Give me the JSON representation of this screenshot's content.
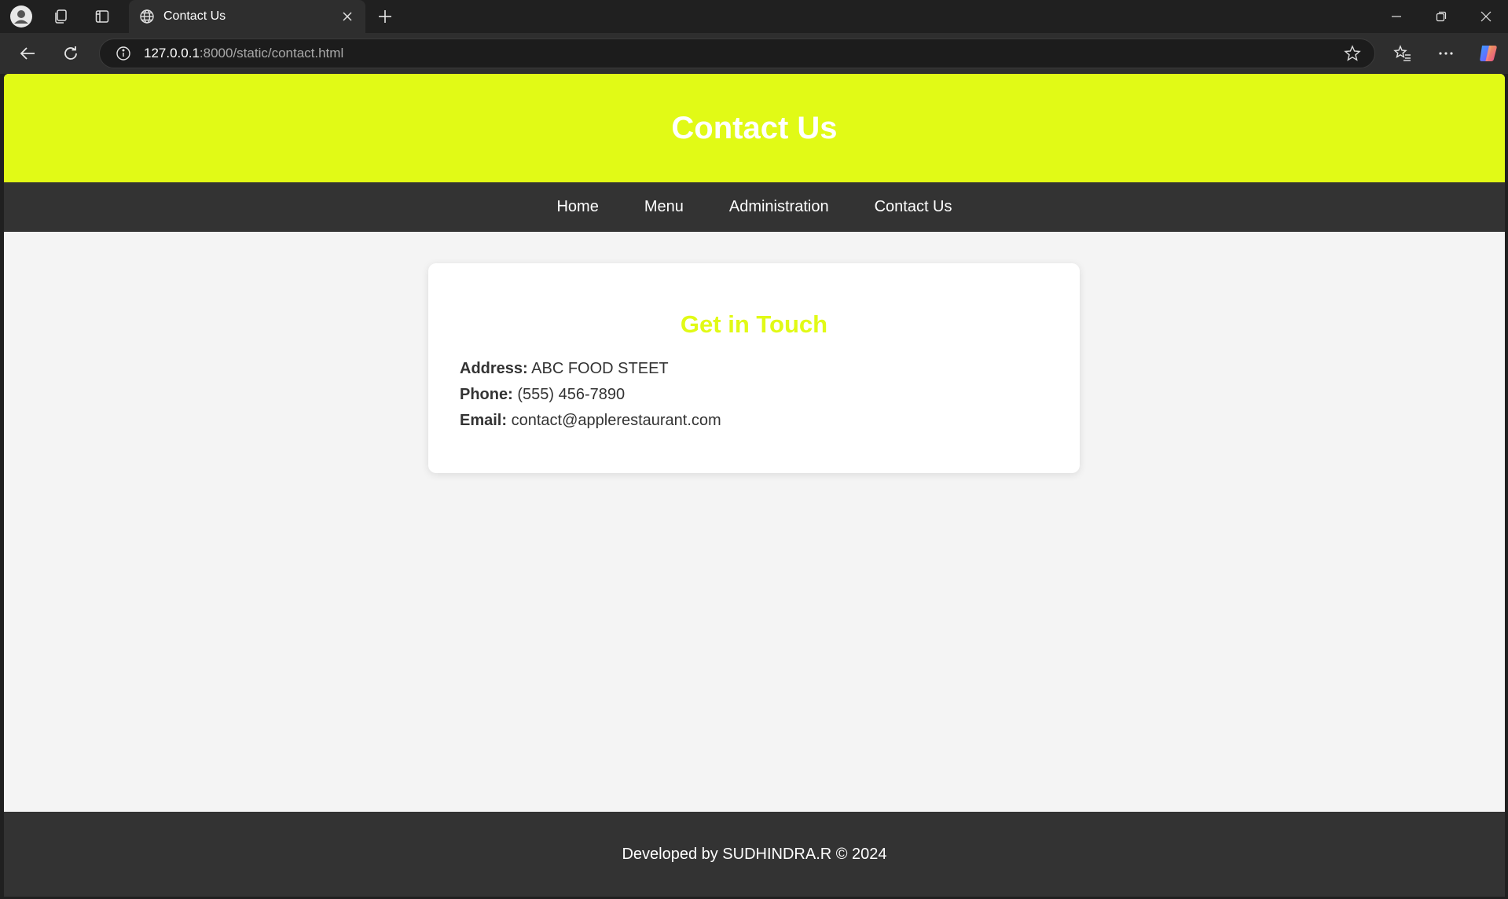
{
  "browser": {
    "tab": {
      "title": "Contact Us"
    },
    "address": {
      "host": "127.0.0.1",
      "rest": ":8000/static/contact.html"
    },
    "icons": {
      "profile": "profile-icon",
      "workspaces": "workspaces-icon",
      "tab_actions": "tab-actions-icon",
      "favicon": "globe-icon",
      "close_tab": "close-icon",
      "new_tab": "plus-icon",
      "back": "back-arrow-icon",
      "reload": "reload-icon",
      "site_info": "info-icon",
      "favorite": "star-icon",
      "favorites": "favorites-icon",
      "more": "more-icon",
      "copilot": "copilot-icon"
    }
  },
  "page": {
    "header": {
      "title": "Contact Us",
      "bg_color": "#e1fa16"
    },
    "nav": {
      "items": [
        {
          "label": "Home"
        },
        {
          "label": "Menu"
        },
        {
          "label": "Administration"
        },
        {
          "label": "Contact Us"
        }
      ]
    },
    "contact": {
      "heading": "Get in Touch",
      "address": {
        "label": "Address:",
        "value": "ABC FOOD STEET"
      },
      "phone": {
        "label": "Phone:",
        "value": "(555) 456-7890"
      },
      "email": {
        "label": "Email:",
        "value": "contact@applerestaurant.com"
      }
    },
    "footer": {
      "text": "Developed by SUDHINDRA.R © 2024"
    }
  }
}
